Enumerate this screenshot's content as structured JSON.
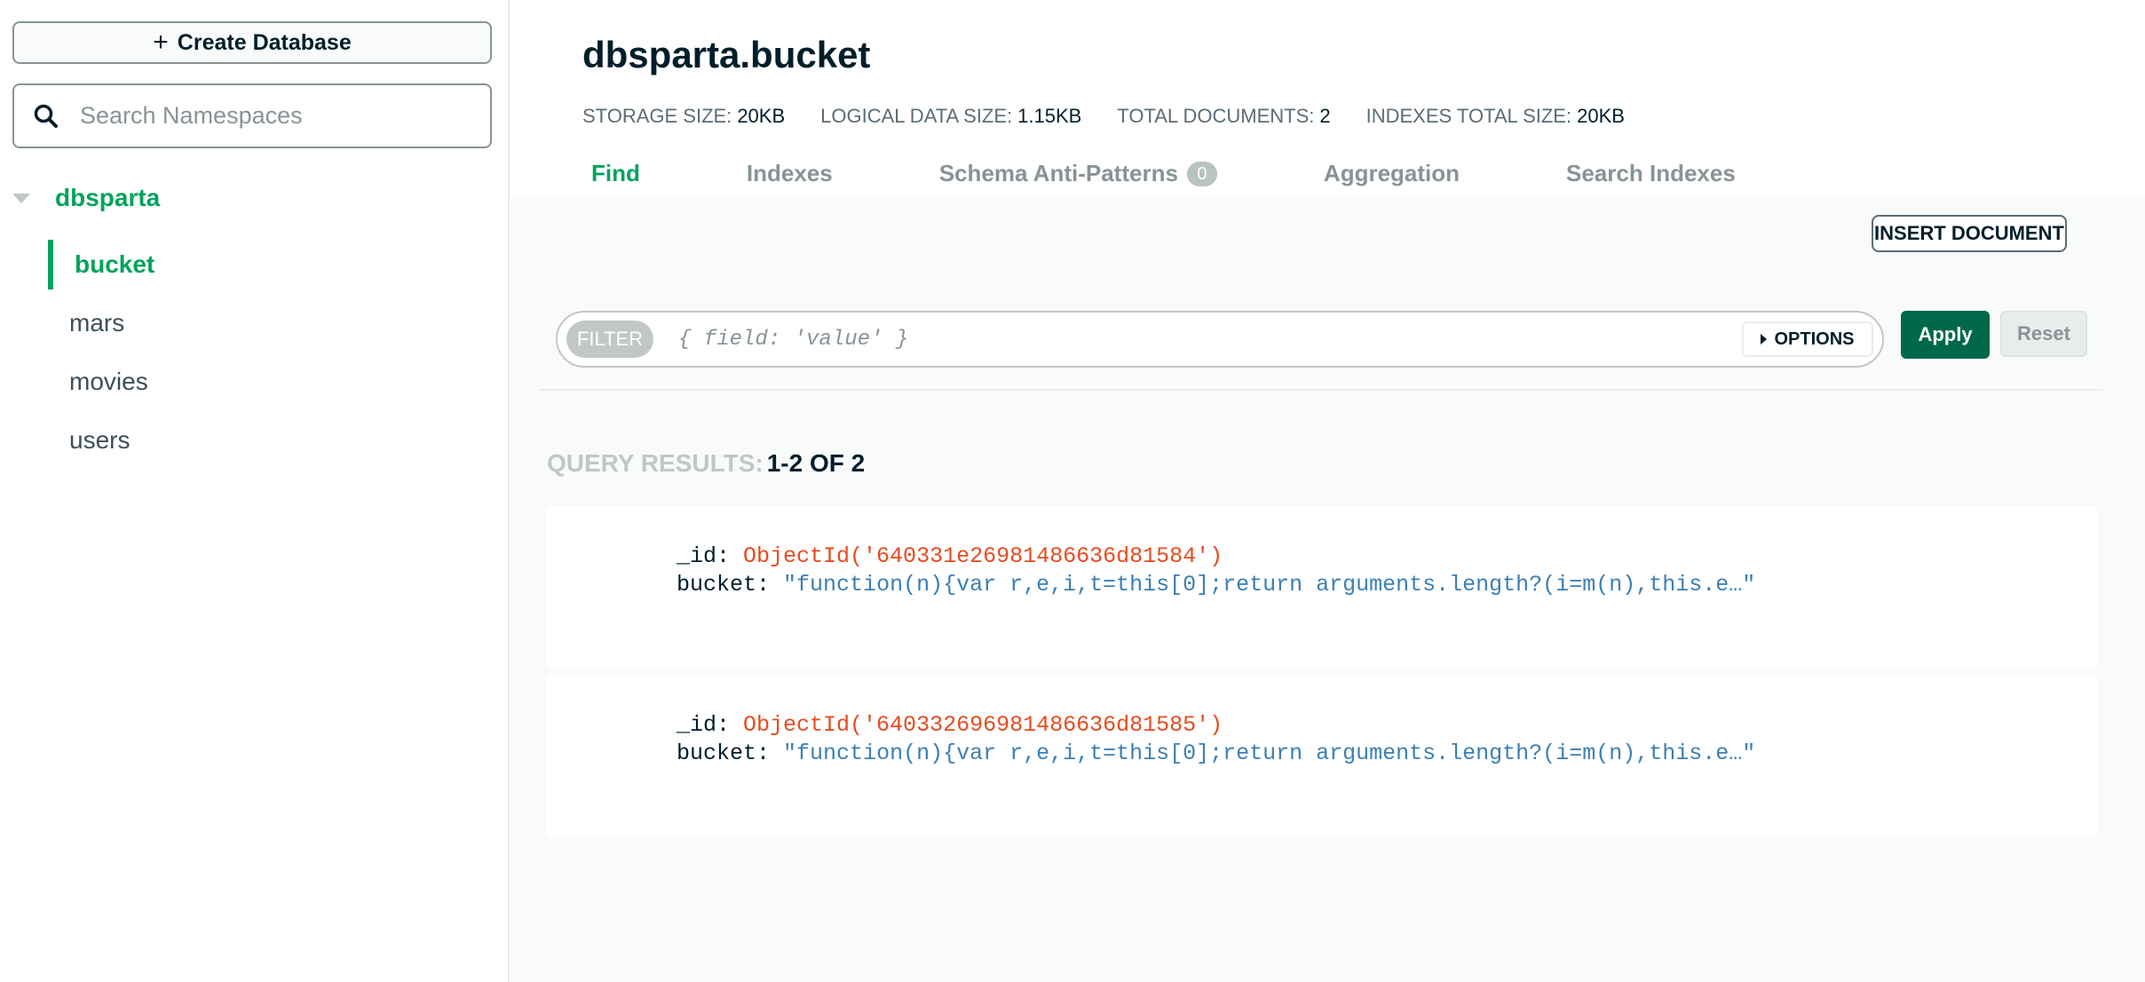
{
  "sidebar": {
    "create_db_label": "Create Database",
    "search_placeholder": "Search Namespaces",
    "database": "dbsparta",
    "collections": [
      "bucket",
      "mars",
      "movies",
      "users"
    ]
  },
  "header": {
    "title": "dbsparta.bucket",
    "stats": {
      "storage_label": "STORAGE SIZE:",
      "storage_value": "20KB",
      "logical_label": "LOGICAL DATA SIZE:",
      "logical_value": "1.15KB",
      "docs_label": "TOTAL DOCUMENTS:",
      "docs_value": "2",
      "indexes_label": "INDEXES TOTAL SIZE:",
      "indexes_value": "20KB"
    },
    "tabs": {
      "find": "Find",
      "indexes": "Indexes",
      "schema": "Schema Anti-Patterns",
      "schema_count": "0",
      "aggregation": "Aggregation",
      "search_indexes": "Search Indexes"
    }
  },
  "toolbar": {
    "insert_label": "INSERT DOCUMENT",
    "filter_label": "FILTER",
    "filter_placeholder": "{ field: 'value' }",
    "options_label": "OPTIONS",
    "apply_label": "Apply",
    "reset_label": "Reset"
  },
  "results": {
    "label": "QUERY RESULTS:",
    "count": "1-2 OF 2",
    "documents": [
      {
        "id_key": "_id:",
        "id_value": "ObjectId('640331e26981486636d81584')",
        "bucket_key": "bucket:",
        "bucket_value": "\"function(n){var r,e,i,t=this[0];return arguments.length?(i=m(n),this.e…\""
      },
      {
        "id_key": "_id:",
        "id_value": "ObjectId('640332696981486636d81585')",
        "bucket_key": "bucket:",
        "bucket_value": "\"function(n){var r,e,i,t=this[0];return arguments.length?(i=m(n),this.e…\""
      }
    ]
  },
  "colors": {
    "accent_green": "#00a35c",
    "apply_green": "#00684a",
    "object_id": "#e64b1e",
    "string_value": "#3b7fb6"
  }
}
